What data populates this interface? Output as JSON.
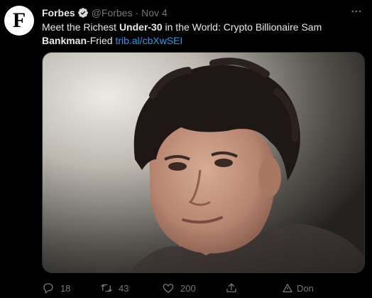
{
  "tweet": {
    "avatar_letter": "F",
    "name": "Forbes",
    "handle": "@Forbes",
    "separator": "·",
    "date": "Nov 4",
    "more_label": "···",
    "text_parts": {
      "p1": "Meet the Richest ",
      "b1": "Under-30",
      "p2": " in the World: Crypto Billionaire Sam ",
      "b2": "Bankman",
      "p3": "-Fried ",
      "link": "trib.al/cbXwSEI"
    },
    "actions": {
      "reply_count": "18",
      "retweet_count": "43",
      "like_count": "200",
      "extension_label": "Don"
    }
  },
  "colors": {
    "background": "#000000",
    "text": "#e7e9ea",
    "secondary": "#71767b",
    "link": "#1d9bf0",
    "verified": "#d9d9d9"
  }
}
